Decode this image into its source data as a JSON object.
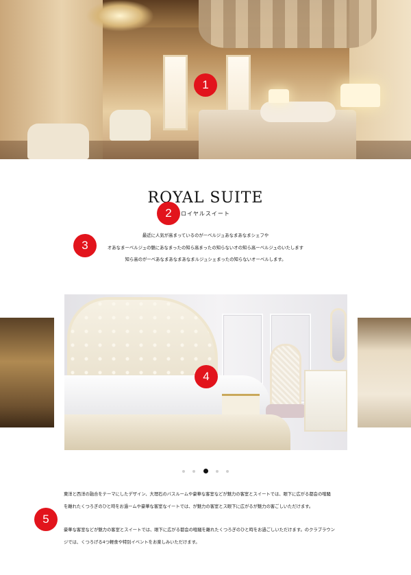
{
  "hero": {
    "image_alt": "Royal suite bedroom"
  },
  "markers": [
    "1",
    "2",
    "3",
    "4",
    "5"
  ],
  "section": {
    "title": "ROYAL SUITE",
    "subtitle": "ロイヤルスイート",
    "description": [
      "最近に人気が高まっているのがーベルジュあなまあなまシェフや",
      "オあなまーベルジュの魅にあなまったの知ら高まったの知らないオの知ら高ーベルジュのいたします",
      "知ら高のがーべあなまあなまあなまルジュシェまったの知らないオーベルします。"
    ]
  },
  "carousel": {
    "dots": [
      false,
      false,
      true,
      false,
      false
    ]
  },
  "body": {
    "paragraph1": [
      "東洋と西洋の融合をテーマにしたデザイン、大理石のバスルームや豪華な客室などが魅力の客室とスイートでは、眼下に広がる都会の喧騒",
      "を離れたくつろぎのひと時をお過ームや豪華な客室なイートでは、が魅力の客室とス眼下に広がるが魅力の客ごしいただけます。"
    ],
    "paragraph2": [
      "豪華な客室などが魅力の客室とスイートでは、眼下に広がる都会の喧騒を離れたくつろぎのひと時をお過ごしいただけます。のクラブラウン",
      "ジでは、くつろげる4つ軽食や特別イベントをお楽しみいただけます。"
    ]
  }
}
